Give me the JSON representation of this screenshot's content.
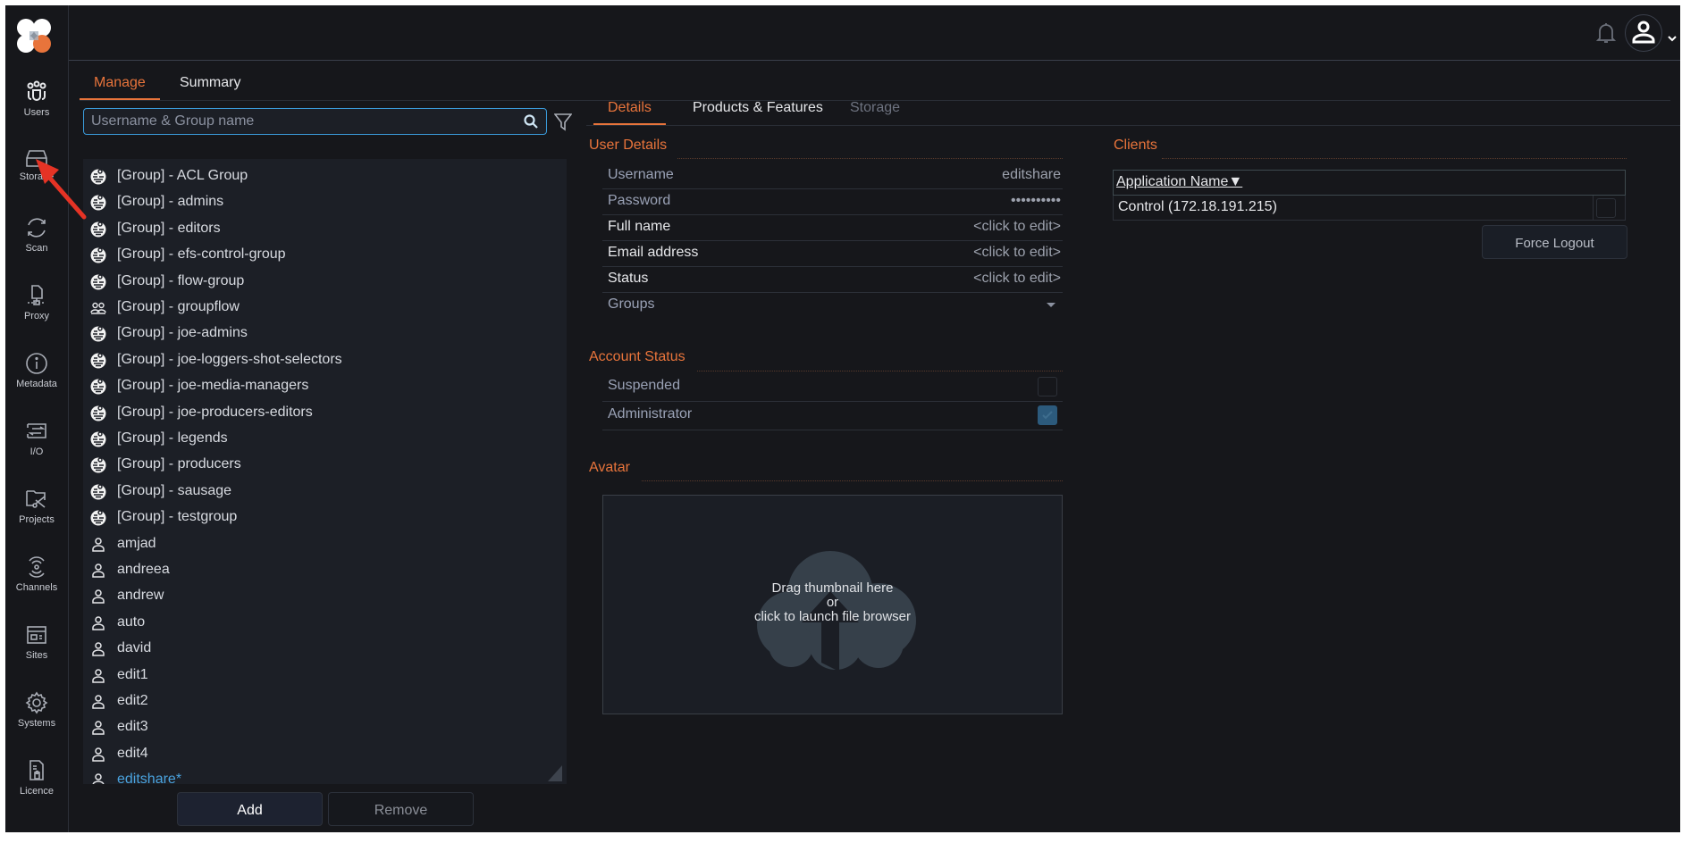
{
  "sidebar": {
    "items": [
      {
        "label": "Users",
        "icon": "users-icon"
      },
      {
        "label": "Storage",
        "icon": "storage-icon"
      },
      {
        "label": "Scan",
        "icon": "scan-icon"
      },
      {
        "label": "Proxy",
        "icon": "proxy-icon"
      },
      {
        "label": "Metadata",
        "icon": "info-icon"
      },
      {
        "label": "I/O",
        "icon": "io-icon"
      },
      {
        "label": "Projects",
        "icon": "projects-icon"
      },
      {
        "label": "Channels",
        "icon": "channels-icon"
      },
      {
        "label": "Sites",
        "icon": "sites-icon"
      },
      {
        "label": "Systems",
        "icon": "gear-icon"
      },
      {
        "label": "Licence",
        "icon": "licence-icon"
      }
    ]
  },
  "header": {
    "notifications_icon": "bell-icon",
    "profile_icon": "user-avatar-icon"
  },
  "main_tabs": [
    {
      "label": "Manage",
      "active": true
    },
    {
      "label": "Summary",
      "active": false
    }
  ],
  "search": {
    "placeholder": "Username & Group name",
    "value": ""
  },
  "user_list": [
    {
      "label": "[Group] - ACL Group",
      "type": "group"
    },
    {
      "label": "[Group] - admins",
      "type": "group"
    },
    {
      "label": "[Group] - editors",
      "type": "group"
    },
    {
      "label": "[Group] - efs-control-group",
      "type": "group"
    },
    {
      "label": "[Group] - flow-group",
      "type": "group"
    },
    {
      "label": "[Group] - groupflow",
      "type": "group-plain"
    },
    {
      "label": "[Group] - joe-admins",
      "type": "group"
    },
    {
      "label": "[Group] - joe-loggers-shot-selectors",
      "type": "group"
    },
    {
      "label": "[Group] - joe-media-managers",
      "type": "group"
    },
    {
      "label": "[Group] - joe-producers-editors",
      "type": "group"
    },
    {
      "label": "[Group] - legends",
      "type": "group"
    },
    {
      "label": "[Group] - producers",
      "type": "group"
    },
    {
      "label": "[Group] - sausage",
      "type": "group"
    },
    {
      "label": "[Group] - testgroup",
      "type": "group"
    },
    {
      "label": "amjad",
      "type": "user"
    },
    {
      "label": "andreea",
      "type": "user"
    },
    {
      "label": "andrew",
      "type": "user"
    },
    {
      "label": "auto",
      "type": "user"
    },
    {
      "label": "david",
      "type": "user"
    },
    {
      "label": "edit1",
      "type": "user"
    },
    {
      "label": "edit2",
      "type": "user"
    },
    {
      "label": "edit3",
      "type": "user"
    },
    {
      "label": "edit4",
      "type": "user"
    },
    {
      "label": "editshare*",
      "type": "user",
      "selected": true
    }
  ],
  "list_buttons": {
    "add": "Add",
    "remove": "Remove"
  },
  "detail_tabs": [
    {
      "label": "Details",
      "state": "active"
    },
    {
      "label": "Products & Features",
      "state": "inactive"
    },
    {
      "label": "Storage",
      "state": "disabled"
    }
  ],
  "user_details": {
    "title": "User Details",
    "rows": [
      {
        "label": "Username",
        "value": "editshare"
      },
      {
        "label": "Password",
        "value": "••••••••••"
      },
      {
        "label": "Full name",
        "value": "<click to edit>"
      },
      {
        "label": "Email address",
        "value": "<click to edit>"
      },
      {
        "label": "Status",
        "value": "<click to edit>"
      },
      {
        "label": "Groups",
        "value": ""
      }
    ]
  },
  "account_status": {
    "title": "Account Status",
    "suspended": {
      "label": "Suspended",
      "checked": false
    },
    "administrator": {
      "label": "Administrator",
      "checked": true
    }
  },
  "avatar": {
    "title": "Avatar",
    "drop_line1": "Drag thumbnail here",
    "drop_line2": "or",
    "drop_line3": "click to launch file browser"
  },
  "clients": {
    "title": "Clients",
    "column_header": "Application Name▼",
    "rows": [
      {
        "name": "Control (172.18.191.215)",
        "checked": false
      }
    ],
    "force_logout": "Force Logout"
  },
  "colors": {
    "accent": "#e8743b",
    "selected_link": "#4aa3df",
    "background": "#16171b",
    "annotation_arrow": "#e53325"
  }
}
